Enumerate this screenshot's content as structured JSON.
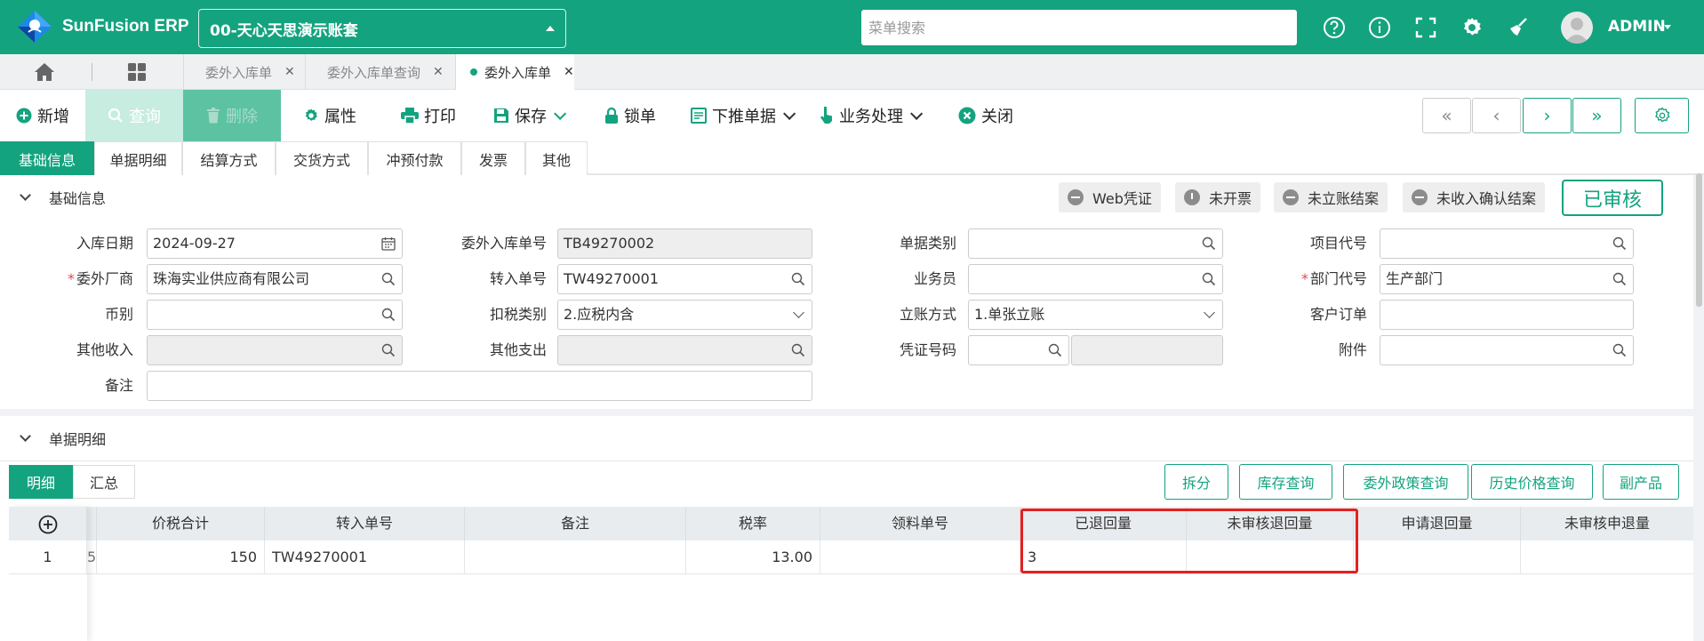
{
  "app": {
    "name": "SunFusion ERP",
    "account": "00-天心天思演示账套",
    "search_placeholder": "菜单搜索",
    "user": "ADMIN",
    "brand_color": "#14a37f"
  },
  "tabs": [
    {
      "label": "委外入库单",
      "active": false
    },
    {
      "label": "委外入库单查询",
      "active": false
    },
    {
      "label": "委外入库单",
      "active": true
    }
  ],
  "toolbar": {
    "new": "新增",
    "query": "查询",
    "delete": "删除",
    "properties": "属性",
    "print": "打印",
    "save": "保存",
    "lock": "锁单",
    "push_down": "下推单据",
    "business": "业务处理",
    "close": "关闭"
  },
  "section_tabs": [
    "基础信息",
    "单据明细",
    "结算方式",
    "交货方式",
    "冲预付款",
    "发票",
    "其他"
  ],
  "basic": {
    "title": "基础信息",
    "chips": [
      "Web凭证",
      "未开票",
      "未立账结案",
      "未收入确认结案"
    ],
    "approved": "已审核",
    "labels": {
      "in_date": "入库日期",
      "vendor": "委外厂商",
      "currency": "币别",
      "other_income": "其他收入",
      "remark": "备注",
      "doc_no": "委外入库单号",
      "transfer_no": "转入单号",
      "tax_type": "扣税类别",
      "other_expense": "其他支出",
      "doc_type": "单据类别",
      "salesman": "业务员",
      "account_mode": "立账方式",
      "voucher_no": "凭证号码",
      "project_code": "项目代号",
      "dept_code": "部门代号",
      "customer_order": "客户订单",
      "attachment": "附件"
    },
    "values": {
      "in_date": "2024-09-27",
      "vendor": "珠海实业供应商有限公司",
      "doc_no": "TB49270002",
      "transfer_no": "TW49270001",
      "tax_type": "2.应税内含",
      "account_mode": "1.单张立账",
      "dept_code": "生产部门"
    }
  },
  "detail": {
    "title": "单据明细",
    "mini_tabs": [
      "明细",
      "汇总"
    ],
    "buttons": [
      "拆分",
      "库存查询",
      "委外政策查询",
      "历史价格查询",
      "副产品"
    ],
    "columns": [
      "价税合计",
      "转入单号",
      "备注",
      "税率",
      "领料单号",
      "已退回量",
      "未审核退回量",
      "申请退回量",
      "未审核申退量"
    ],
    "rows": [
      {
        "no": "1",
        "cut": "5",
        "total": "150",
        "transfer_no": "TW49270001",
        "remark": "",
        "tax_rate": "13.00",
        "pick_no": "",
        "returned": "3",
        "unaudited_returned": "",
        "apply_return": "",
        "unaudited_apply": ""
      }
    ]
  }
}
